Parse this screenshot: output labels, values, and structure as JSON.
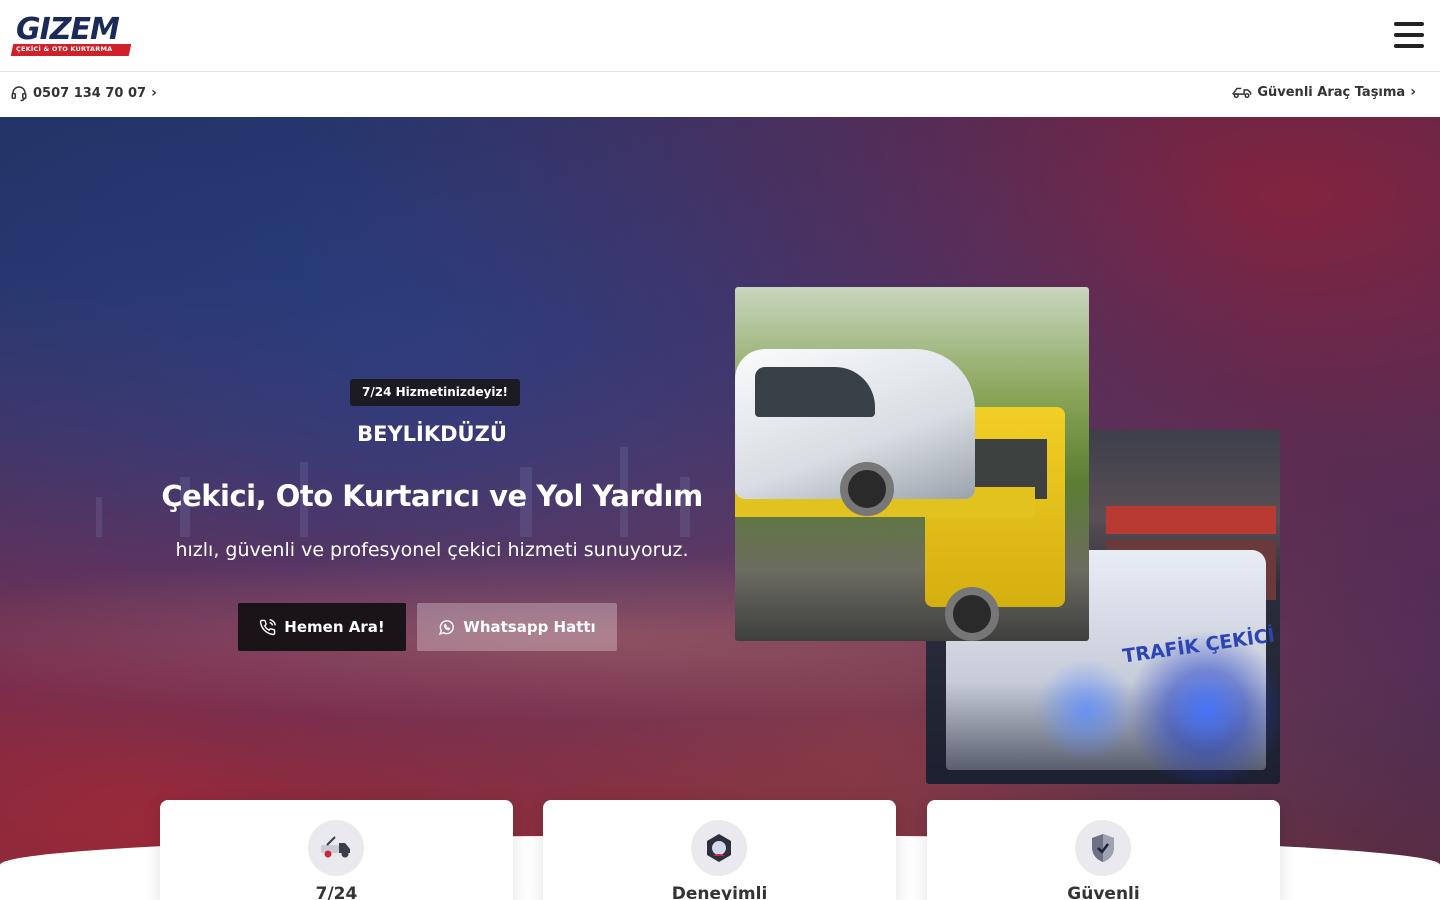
{
  "header": {
    "logo_text": "GIZEM",
    "logo_subtext": "ÇEKİCİ & OTO KURTARMA",
    "menu_icon": "hamburger-menu-icon"
  },
  "subbar": {
    "phone": "0507 134 70 07",
    "transport_label": "Güvenli Araç Taşıma"
  },
  "hero": {
    "badge": "7/24 Hizmetinizdeyiz!",
    "location": "BEYLİKDÜZÜ",
    "headline": "Çekici, Oto Kurtarıcı ve Yol Yardım",
    "tagline": "hızlı, güvenli ve profesyonel çekici hizmeti sunuyoruz.",
    "call_button": "Hemen Ara!",
    "whatsapp_button": "Whatsapp Hattı",
    "photo_back_text": "TRAFİK ÇEKİCİ"
  },
  "features": [
    {
      "title": "7/24",
      "icon": "tow-truck-icon"
    },
    {
      "title": "Deneyimli",
      "icon": "experience-icon"
    },
    {
      "title": "Güvenli",
      "icon": "shield-check-icon"
    }
  ],
  "colors": {
    "brand_navy": "#1c2a5a",
    "brand_red": "#d0202a",
    "button_dark": "#1a1418"
  }
}
